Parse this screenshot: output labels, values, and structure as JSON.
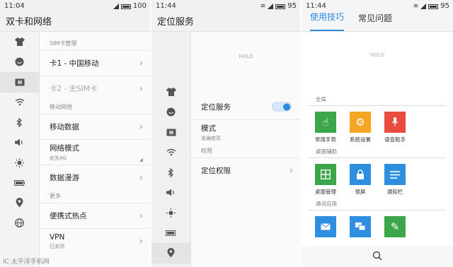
{
  "panel1": {
    "status": {
      "time": "11:04",
      "battery": "100"
    },
    "title": "双卡和网络",
    "side_icons": [
      "shirt-icon",
      "smile-icon",
      "sim-icon",
      "wifi-icon",
      "bluetooth-icon",
      "volume-icon",
      "brightness-icon",
      "battery-icon",
      "location-icon",
      "globe-icon"
    ],
    "sections": {
      "sim": "SIM卡管理",
      "net": "移动网络",
      "more": "更多"
    },
    "rows": {
      "card1": "卡1 - 中国移动",
      "card2": "卡2 - 无SIM卡",
      "mobile_data": "移动数据",
      "network_mode": "网络模式",
      "network_mode_sub": "优先4G",
      "roaming": "数据漫游",
      "hotspot": "便携式热点",
      "vpn": "VPN",
      "vpn_sub": "已关闭"
    }
  },
  "panel2": {
    "status": {
      "time": "11:44",
      "battery": "95"
    },
    "title": "定位服务",
    "hold": "HOLD",
    "rows": {
      "location_service": "定位服务",
      "mode": "模式",
      "mode_sub": "准确度高",
      "perm_section": "权限",
      "location_perm": "定位权限"
    },
    "toggle_on": true
  },
  "panel3": {
    "status": {
      "time": "11:44",
      "battery": "95"
    },
    "tabs": [
      "使用技巧",
      "常见问题"
    ],
    "active_tab": "使用技巧",
    "hold": "HOLD",
    "groups": {
      "global": "全局",
      "desktop": "桌面辅助",
      "comm": "通讯应用"
    },
    "tiles_global": [
      "常用手势",
      "系统设置",
      "语音助手"
    ],
    "tiles_desktop": [
      "桌面管理",
      "锁屏",
      "通知栏"
    ]
  },
  "watermark": "IC 太平洋手机网",
  "colors": {
    "accent": "#2b8ae6",
    "green": "#3ea64a",
    "orange": "#f5a623",
    "red": "#e84c3d",
    "blue": "#2e8fe0"
  }
}
